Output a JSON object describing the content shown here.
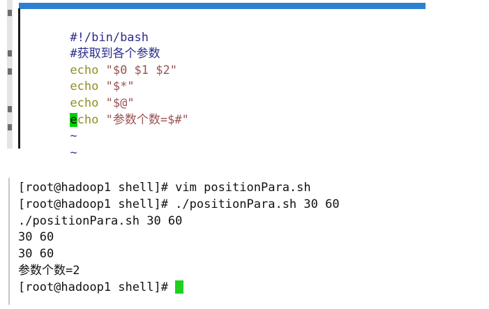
{
  "editor": {
    "lines": [
      {
        "kind": "shebang",
        "text": "#!/bin/bash"
      },
      {
        "kind": "comment",
        "text": "#获取到各个参数"
      },
      {
        "kind": "echo",
        "keyword": "echo",
        "arg": " \"$0 $1 $2\""
      },
      {
        "kind": "echo",
        "keyword": "echo",
        "arg": " \"$*\""
      },
      {
        "kind": "echo",
        "keyword": "echo",
        "arg": " \"$@\""
      },
      {
        "kind": "echo-cursor",
        "cursor_char": "e",
        "keyword_rest": "cho",
        "arg": " \"参数个数=$#\""
      },
      {
        "kind": "tilde",
        "text": "~"
      },
      {
        "kind": "tilde",
        "text": "~"
      }
    ],
    "colors": {
      "comment": "#2c2c8c",
      "keyword": "#8f8f22",
      "string": "#9b5050",
      "tilde": "#3636a0",
      "cursor": "#00d000",
      "titlebar": "#2f7fd0"
    }
  },
  "terminal": {
    "lines": [
      "[root@hadoop1 shell]# vim positionPara.sh",
      "[root@hadoop1 shell]# ./positionPara.sh 30 60",
      "./positionPara.sh 30 60",
      "30 60",
      "30 60",
      "参数个数=2"
    ],
    "prompt": "[root@hadoop1 shell]# ",
    "colors": {
      "text": "#111111",
      "cursor": "#1fd11f"
    }
  }
}
